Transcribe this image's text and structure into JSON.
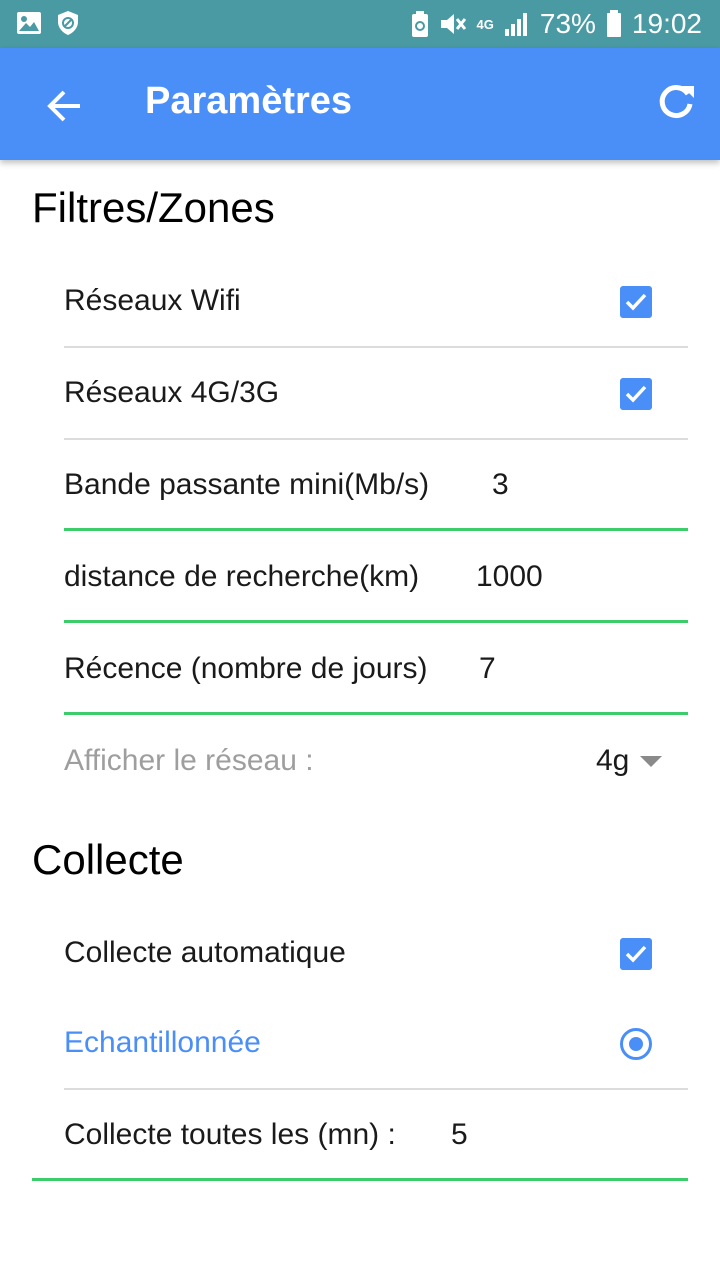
{
  "status_bar": {
    "network": "4G",
    "battery": "73%",
    "time": "19:02",
    "icons": [
      "image-icon",
      "shield-icon",
      "battery-saver-icon",
      "mute-icon",
      "signal-icon",
      "battery-icon"
    ]
  },
  "app_bar": {
    "title": "Paramètres",
    "back_icon": "arrow-back-icon",
    "refresh_icon": "refresh-icon"
  },
  "filters": {
    "title": "Filtres/Zones",
    "wifi": {
      "label": "Réseaux Wifi",
      "checked": true
    },
    "cellular": {
      "label": "Réseaux 4G/3G",
      "checked": true
    },
    "bandwidth": {
      "label": "Bande passante mini(Mb/s)",
      "value": "3"
    },
    "distance": {
      "label": "distance de recherche(km)",
      "value": "1000"
    },
    "recency": {
      "label": "Récence (nombre de jours)",
      "value": "7"
    },
    "display_network": {
      "label": "Afficher le réseau :",
      "value": "4g"
    }
  },
  "collect": {
    "title": "Collecte",
    "auto": {
      "label": "Collecte automatique",
      "checked": true
    },
    "sampled": {
      "label": "Echantillonnée",
      "selected": true
    },
    "interval": {
      "label": "Collecte toutes les (mn) :",
      "value": "5"
    }
  },
  "colors": {
    "accent": "#4a8ef8",
    "status_bar": "#4a9aa4",
    "field_underline": "#3ccc6a"
  }
}
